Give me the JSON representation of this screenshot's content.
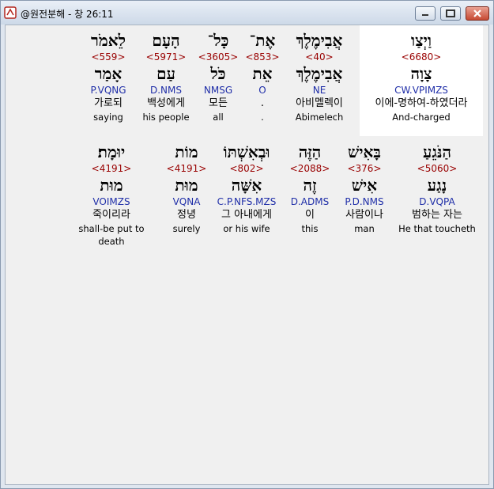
{
  "window": {
    "title": "@원전분해 - 창 26:11"
  },
  "rows": [
    {
      "words": [
        {
          "hebrew": "וַיְצַו",
          "strong": "<6680>",
          "lemma": "צָוָה",
          "parse": "CW.VPIMZS",
          "korean": "이에-명하여-하였더라",
          "english": "And-charged"
        },
        {
          "hebrew": "אֲבִימֶלֶךְ",
          "strong": "<40>",
          "lemma": "אֲבִימֶלֶךְ",
          "parse": "NE",
          "korean": "아비멜렉이",
          "english": "Abimelech"
        },
        {
          "hebrew": "אֶת־",
          "strong": "<853>",
          "lemma": "אֵת",
          "parse": "O",
          "korean": ".",
          "english": "."
        },
        {
          "hebrew": "כָּל־",
          "strong": "<3605>",
          "lemma": "כֹּל",
          "parse": "NMSG",
          "korean": "모든",
          "english": "all"
        },
        {
          "hebrew": "הָעָם",
          "strong": "<5971>",
          "lemma": "עַם",
          "parse": "D.NMS",
          "korean": "백성에게",
          "english": "his people"
        },
        {
          "hebrew": "לֵאמֹר",
          "strong": "<559>",
          "lemma": "אָמַר",
          "parse": "P.VQNG",
          "korean": "가로되",
          "english": "saying"
        }
      ]
    },
    {
      "words": [
        {
          "hebrew": "הַנֹּגֵעַ",
          "strong": "<5060>",
          "lemma": "נָגַע",
          "parse": "D.VQPA",
          "korean": "범하는 자는",
          "english": "He that toucheth"
        },
        {
          "hebrew": "בָּאִישׁ",
          "strong": "<376>",
          "lemma": "אִישׁ",
          "parse": "P.D.NMS",
          "korean": "사람이나",
          "english": "man"
        },
        {
          "hebrew": "הַזֶּה",
          "strong": "<2088>",
          "lemma": "זֶה",
          "parse": "D.ADMS",
          "korean": "이",
          "english": "this"
        },
        {
          "hebrew": "וּבְאִשְׁתּוֹ",
          "strong": "<802>",
          "lemma": "אִשָּׁה",
          "parse": "C.P.NFS.MZS",
          "korean": "그 아내에게",
          "english": "or his wife"
        },
        {
          "hebrew": "מוֹת",
          "strong": "<4191>",
          "lemma": "מוּת",
          "parse": "VQNA",
          "korean": "정녕",
          "english": "surely"
        },
        {
          "hebrew": "יוּמָת׃",
          "strong": "<4191>",
          "lemma": "מוּת",
          "parse": "VOIMZS",
          "korean": "죽이리라",
          "english": "shall-be put to death"
        }
      ]
    }
  ]
}
